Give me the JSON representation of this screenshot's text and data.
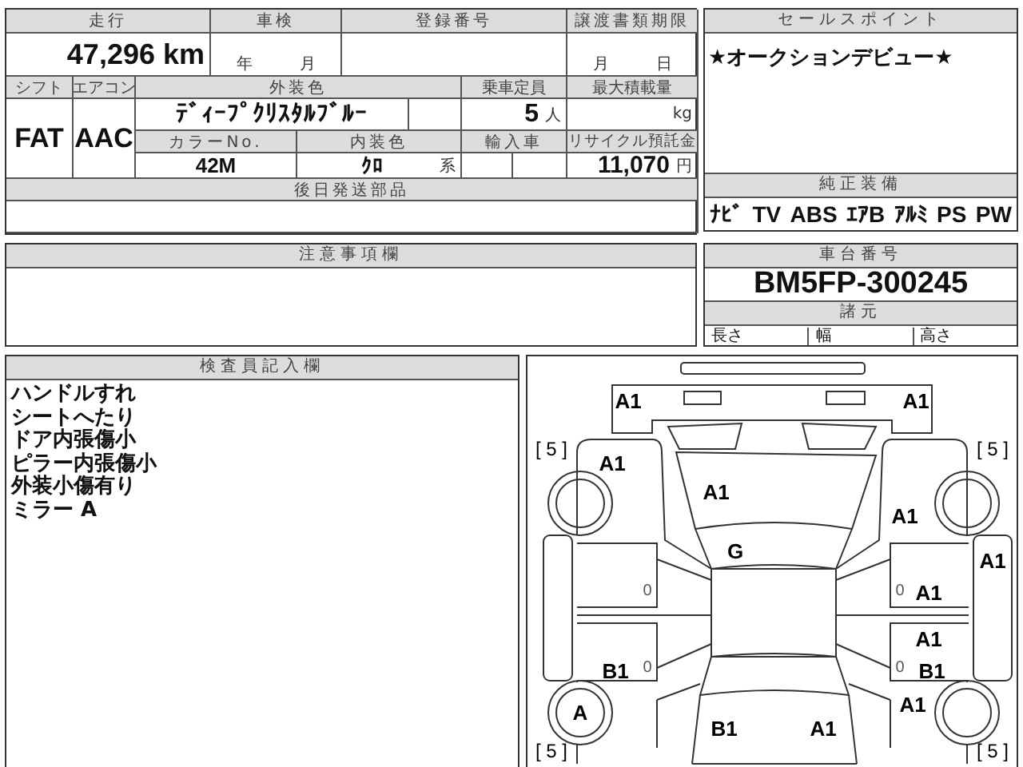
{
  "vehicle_table": {
    "mileage_label": "走行",
    "mileage": "47,296 km",
    "inspection_label": "車検",
    "inspection_year_unit": "年",
    "inspection_month_unit": "月",
    "registration_label": "登録番号",
    "transfer_deadline_label": "譲渡書類期限",
    "transfer_month_unit": "月",
    "transfer_day_unit": "日",
    "shift_label": "シフト",
    "shift": "FAT",
    "ac_label": "エアコン",
    "ac": "AAC",
    "exterior_color_label": "外装色",
    "exterior_color": "ﾃﾞｨｰﾌﾟｸﾘｽﾀﾙﾌﾞﾙｰ",
    "capacity_label": "乗車定員",
    "capacity": "5",
    "capacity_unit": "人",
    "max_load_label": "最大積載量",
    "max_load_unit": "kg",
    "color_no_label": "カラーNo.",
    "color_no": "42M",
    "interior_color_label": "内装色",
    "interior_color": "ｸﾛ",
    "interior_color_unit": "系",
    "import_label": "輸入車",
    "recycle_label": "リサイクル預託金",
    "recycle_fee": "11,070",
    "recycle_unit": "円",
    "later_parts_label": "後日発送部品"
  },
  "sales_points": {
    "label": "セールスポイント",
    "text": "★オークションデビュー★"
  },
  "equipment": {
    "label": "純正装備",
    "items": [
      "ﾅﾋﾞ",
      "TV",
      "ABS",
      "ｴｱB",
      "ｱﾙﾐ",
      "PS",
      "PW"
    ]
  },
  "notes": {
    "label": "注意事項欄"
  },
  "chassis": {
    "label": "車台番号",
    "number": "BM5FP-300245",
    "spec_label": "諸元",
    "length_label": "長さ",
    "width_label": "幅",
    "height_label": "高さ"
  },
  "inspector": {
    "label": "検査員記入欄",
    "lines": [
      "ハンドルすれ",
      "シートへたり",
      "ドア内張傷小",
      "ピラー内張傷小",
      "外装小傷有り",
      "ミラー A"
    ]
  },
  "diagram": {
    "damage_marks": [
      "A1",
      "A1",
      "A1",
      "A1",
      "A1",
      "G",
      "A1",
      "A1",
      "A1",
      "B1",
      "B1",
      "A1",
      "A",
      "B1",
      "A1"
    ],
    "tire_treads": [
      "[ 5 ]",
      "[ 5 ]",
      "[ 5 ]",
      "[ 5 ]"
    ],
    "minor_marks": [
      "0",
      "0",
      "0",
      "0"
    ]
  }
}
